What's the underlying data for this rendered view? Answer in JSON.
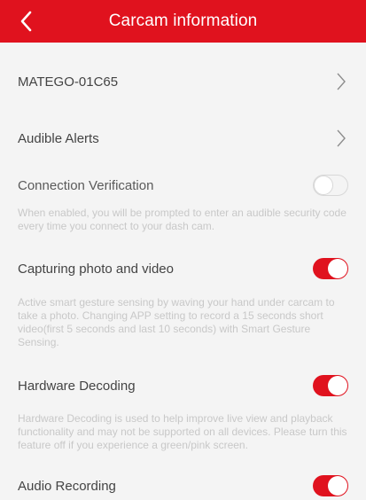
{
  "header": {
    "title": "Carcam information",
    "back_icon": "chevron-left-icon"
  },
  "device_row": {
    "label": "MATEGO-01C65",
    "chevron_icon": "chevron-right-icon"
  },
  "audible_alerts_row": {
    "label": "Audible Alerts",
    "chevron_icon": "chevron-right-icon"
  },
  "connection_verification": {
    "label": "Connection Verification",
    "enabled": false,
    "description": "When enabled, you will be prompted to enter an audible security code every time you connect to your dash cam."
  },
  "capturing_photo_video": {
    "label": "Capturing photo and video",
    "enabled": true,
    "description": "Active smart gesture sensing by waving your hand under carcam to take a photo. Changing APP setting to record a 15 seconds short video(first 5 seconds and last 10 seconds) with Smart Gesture Sensing."
  },
  "hardware_decoding": {
    "label": "Hardware Decoding",
    "enabled": true,
    "description": "Hardware Decoding is used to help improve live view and playback functionality and may not be supported on all devices. Please turn this feature off if you experience a green/pink screen."
  },
  "audio_recording": {
    "label": "Audio Recording",
    "enabled": true
  },
  "colors": {
    "accent": "#e0121e",
    "background": "#f4f4f4",
    "description_text": "#c8c8c8"
  }
}
